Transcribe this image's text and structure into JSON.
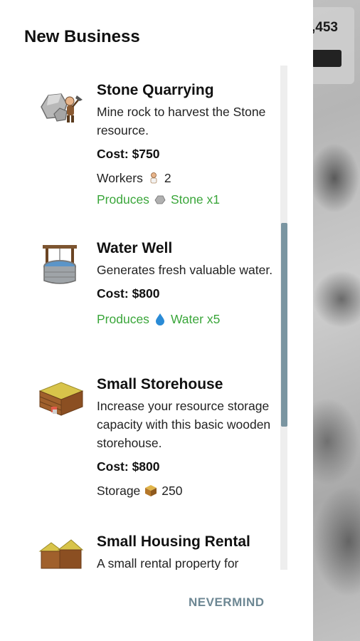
{
  "hud": {
    "money_value": ",453"
  },
  "dialog": {
    "title": "New Business",
    "nevermind_label": "NEVERMIND",
    "items": [
      {
        "name": "Stone Quarrying",
        "icon": "stone-quarry-icon",
        "description": "Mine rock to harvest the Stone resource.",
        "cost": "Cost: $750",
        "stat_label": "Workers",
        "stat_icon": "worker-icon",
        "stat_value": "2",
        "produces_label": "Produces",
        "produces_icon": "stone-icon",
        "produces_value": "Stone x1"
      },
      {
        "name": "Water Well",
        "icon": "water-well-icon",
        "description": "Generates fresh valuable water.",
        "cost": "Cost: $800",
        "produces_label": "Produces",
        "produces_icon": "water-drop-icon",
        "produces_value": "Water x5"
      },
      {
        "name": "Small Storehouse",
        "icon": "storehouse-icon",
        "description": "Increase your resource storage capacity with this basic wooden storehouse.",
        "cost": "Cost: $800",
        "stat_label": "Storage",
        "stat_icon": "crate-icon",
        "stat_value": "250"
      },
      {
        "name": "Small Housing Rental",
        "icon": "housing-rental-icon",
        "description": "A small rental property for"
      }
    ]
  },
  "colors": {
    "produces_green": "#3aa63a",
    "nevermind": "#6d8793",
    "scroll_thumb": "#7a95a1"
  }
}
